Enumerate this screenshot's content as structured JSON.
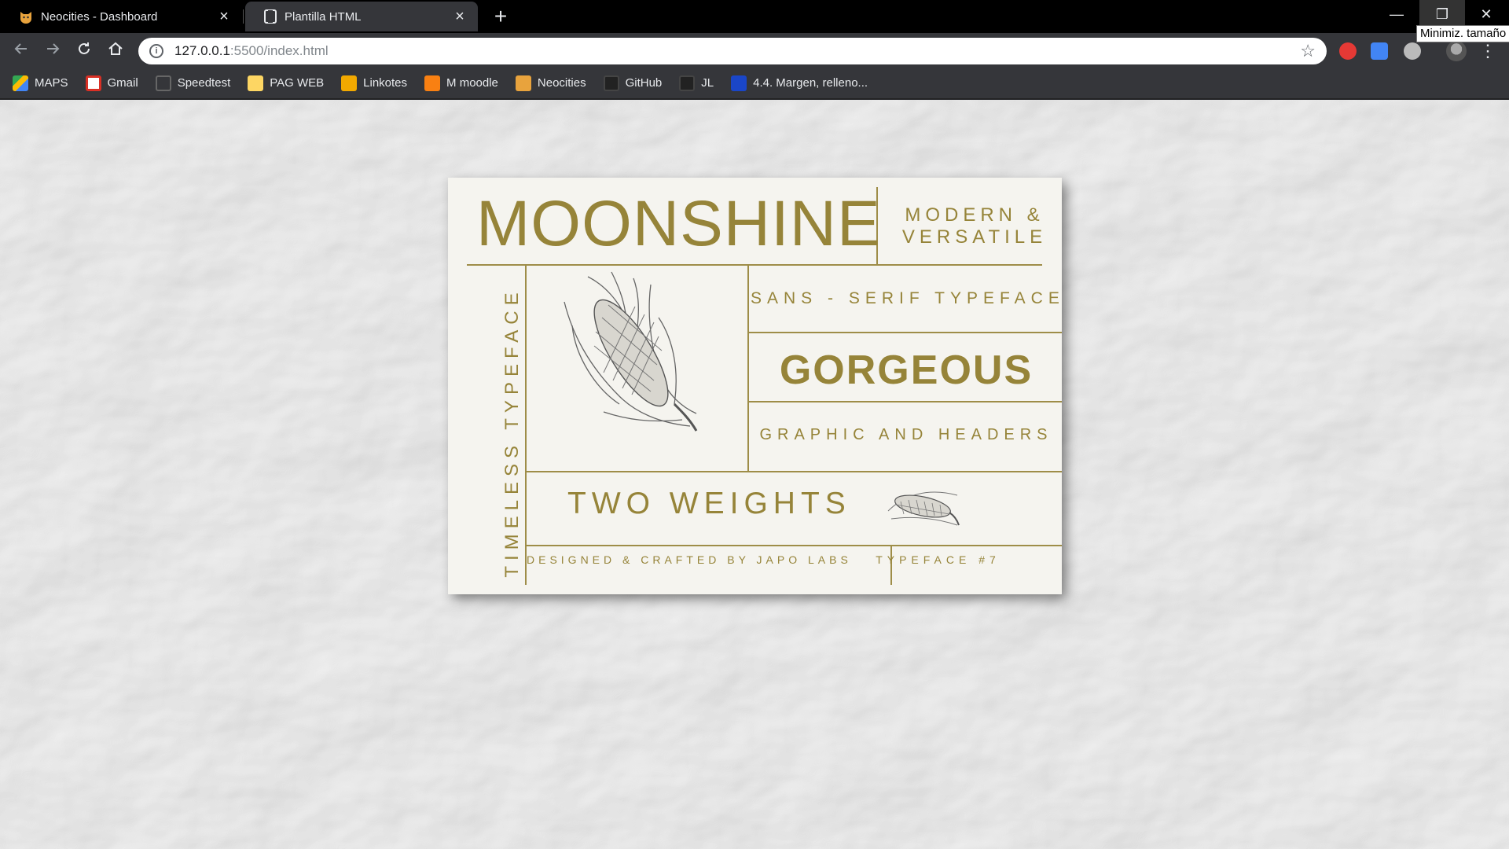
{
  "browser": {
    "tabs": [
      {
        "title": "Neocities - Dashboard",
        "icon": "neocities-cat-icon",
        "active": false
      },
      {
        "title": "Plantilla HTML",
        "icon": "code-editor-icon",
        "active": true
      }
    ],
    "new_tab": "+",
    "window_controls": {
      "minimize": "—",
      "restore": "❐",
      "close": "✕"
    },
    "tooltip": "Minimiz. tamaño",
    "url": {
      "host": "127.0.0.1",
      "rest": ":5500/index.html"
    },
    "bookmarks": [
      {
        "label": "MAPS",
        "icon": "google-maps-icon"
      },
      {
        "label": "Gmail",
        "icon": "gmail-icon"
      },
      {
        "label": "Speedtest",
        "icon": "speedtest-icon"
      },
      {
        "label": "PAG WEB",
        "icon": "folder-icon"
      },
      {
        "label": "Linkotes",
        "icon": "linkotes-icon"
      },
      {
        "label": "M moodle",
        "icon": "moodle-icon"
      },
      {
        "label": "Neocities",
        "icon": "neocities-cat-icon"
      },
      {
        "label": "GitHub",
        "icon": "github-icon"
      },
      {
        "label": "JL",
        "icon": "github-icon"
      },
      {
        "label": "4.4. Margen, relleno...",
        "icon": "site-icon"
      }
    ]
  },
  "card": {
    "title": "MOONSHINE",
    "tagline": "MODERN & VERSATILE",
    "vertical": "TIMELESS TYPEFACE",
    "sans": "SANS - SERIF TYPEFACE",
    "headline": "GORGEOUS",
    "graphic": "GRAPHIC AND HEADERS",
    "weights": "TWO WEIGHTS",
    "credit": "DESIGNED & CRAFTED BY JAPO LABS",
    "number": "TYPEFACE #7",
    "accent_color": "#968439"
  }
}
